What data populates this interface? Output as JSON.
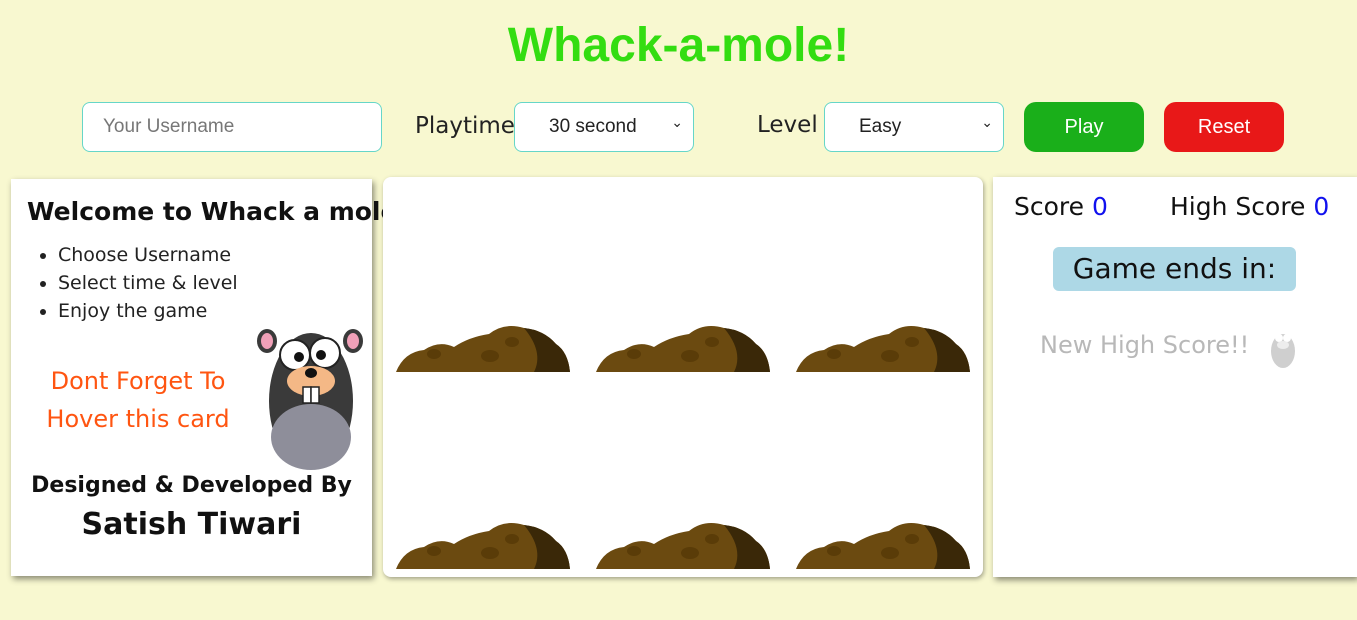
{
  "header": {
    "title": "Whack-a-mole!"
  },
  "controls": {
    "username_placeholder": "Your Username",
    "playtime_label": "Playtime",
    "playtime_value": "30 second",
    "level_label": "Level",
    "level_value": "Easy",
    "play_label": "Play",
    "reset_label": "Reset"
  },
  "info_card": {
    "welcome": "Welcome to Whack a mole",
    "steps": [
      "Choose Username",
      "Select time & level",
      "Enjoy the game"
    ],
    "hover_note": "Dont Forget To Hover this card",
    "designed_by": "Designed & Developed By",
    "author": "Satish Tiwari"
  },
  "scoreboard": {
    "score_label": "Score",
    "score_value": "0",
    "high_label": "High Score",
    "high_value": "0",
    "ends_label": "Game ends in:",
    "new_high_label": "New High Score!!"
  },
  "colors": {
    "title": "#33dd11",
    "play": "#1aaf1a",
    "reset": "#e81818",
    "background": "#f8f8d0",
    "accent_blue": "#1111ee"
  },
  "board": {
    "holes": 6
  }
}
